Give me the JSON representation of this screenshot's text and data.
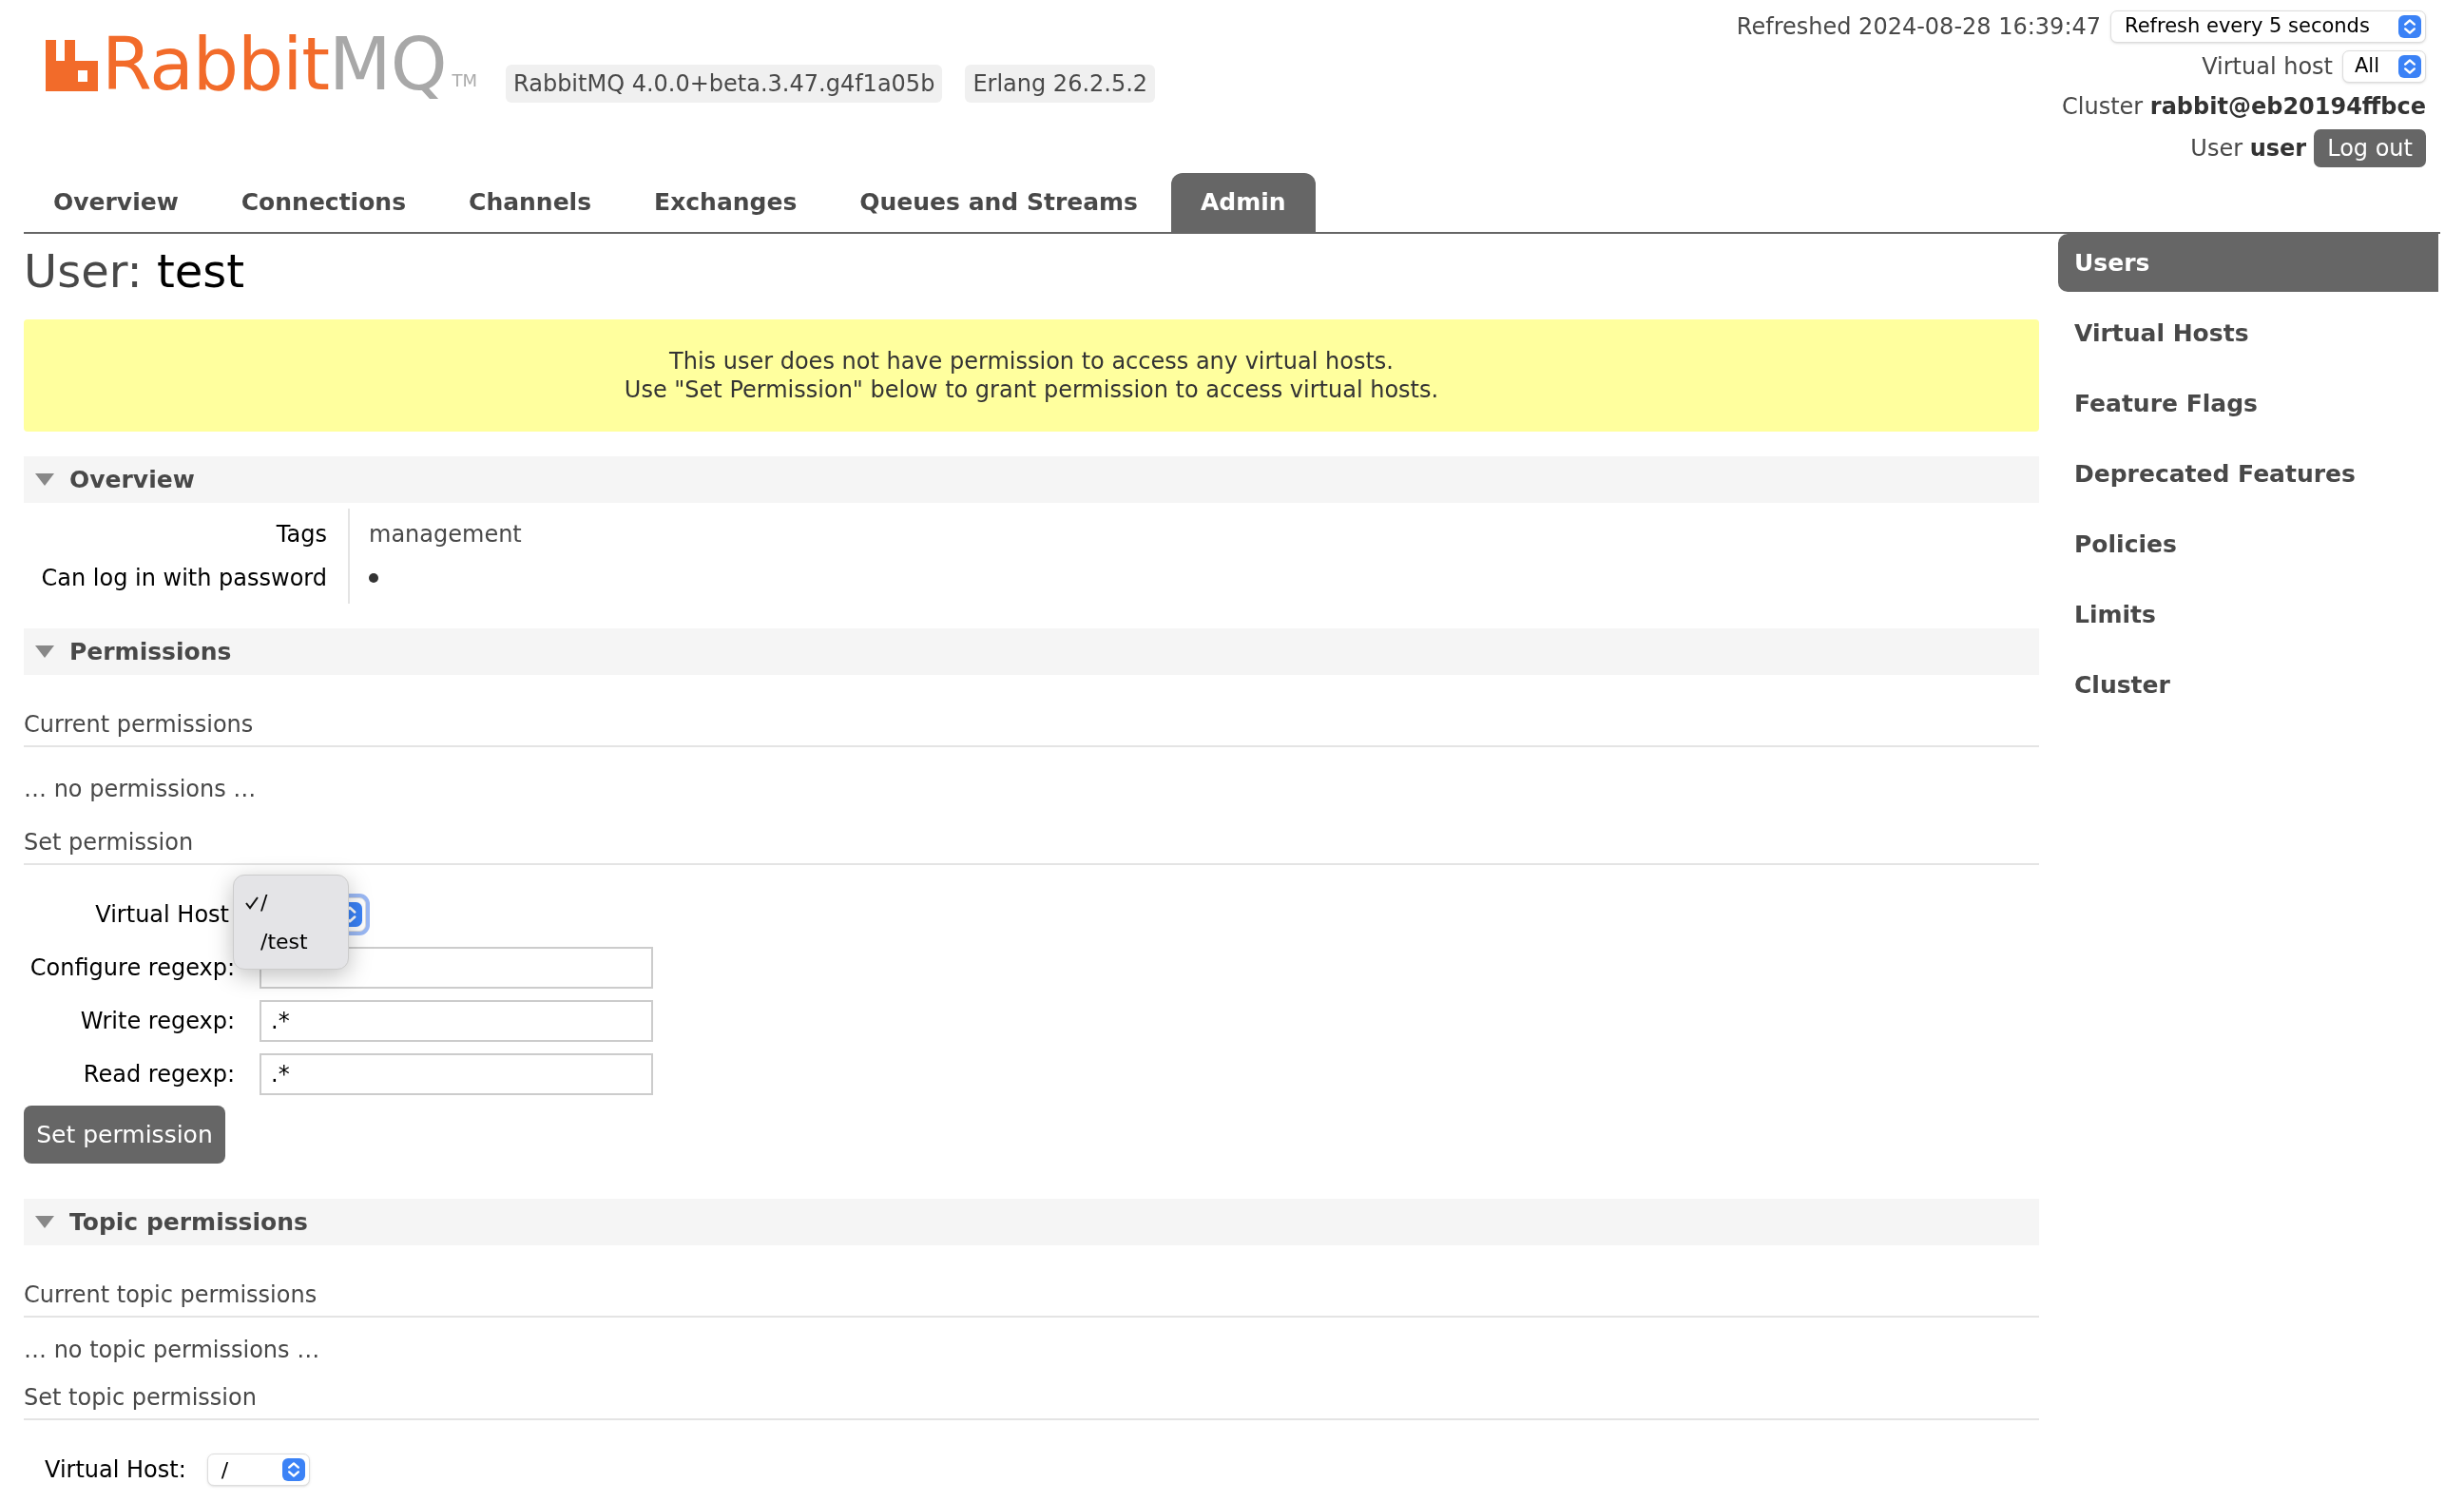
{
  "header": {
    "logo": {
      "brand": "Rabbit",
      "suffix": "MQ",
      "trademark": "TM"
    },
    "badges": [
      "RabbitMQ 4.0.0+beta.3.47.g4f1a05b",
      "Erlang 26.2.5.2"
    ],
    "refreshed": "Refreshed 2024-08-28 16:39:47",
    "refresh_select": "Refresh every 5 seconds",
    "vhost_label": "Virtual host",
    "vhost_select": "All",
    "cluster_label": "Cluster",
    "cluster": "rabbit@eb20194ffbce",
    "user_label": "User",
    "user": "user",
    "logout": "Log out"
  },
  "tabs": [
    {
      "label": "Overview",
      "selected": false
    },
    {
      "label": "Connections",
      "selected": false
    },
    {
      "label": "Channels",
      "selected": false
    },
    {
      "label": "Exchanges",
      "selected": false
    },
    {
      "label": "Queues and Streams",
      "selected": false
    },
    {
      "label": "Admin",
      "selected": true
    }
  ],
  "page_title": {
    "label": "User:",
    "name": "test"
  },
  "notice": [
    "This user does not have permission to access any virtual hosts.",
    "Use \"Set Permission\" below to grant permission to access virtual hosts."
  ],
  "overview": {
    "title": "Overview",
    "expanded": true,
    "rows": [
      {
        "label": "Tags",
        "kind": "text",
        "value": "management"
      },
      {
        "label": "Can log in with password",
        "kind": "boolean",
        "on": true
      }
    ]
  },
  "permissions": {
    "title": "Permissions",
    "expanded": true,
    "current_heading": "Current permissions",
    "empty": "… no permissions …",
    "set_heading": "Set permission",
    "fields": [
      {
        "label": "Virtual Host",
        "kind": "select",
        "open": true,
        "options": [
          {
            "label": "/",
            "selected": true
          },
          {
            "label": "/test",
            "selected": false
          }
        ]
      },
      {
        "label": "Configure regexp:",
        "kind": "text"
      },
      {
        "label": "Write regexp:",
        "kind": "text",
        "value": ".*"
      },
      {
        "label": "Read regexp:",
        "kind": "text",
        "value": ".*"
      }
    ],
    "button": "Set permission"
  },
  "topic_permissions": {
    "title": "Topic permissions",
    "expanded": true,
    "current_heading": "Current topic permissions",
    "empty": "… no topic permissions …",
    "set_heading": "Set topic permission",
    "vhost_label": "Virtual Host:",
    "vhost_value": "/"
  },
  "sidebar": {
    "items": [
      {
        "label": "Users",
        "selected": true
      },
      {
        "label": "Virtual Hosts",
        "selected": false
      },
      {
        "label": "Feature Flags",
        "selected": false
      },
      {
        "label": "Deprecated Features",
        "selected": false
      },
      {
        "label": "Policies",
        "selected": false
      },
      {
        "label": "Limits",
        "selected": false
      },
      {
        "label": "Cluster",
        "selected": false
      }
    ]
  }
}
